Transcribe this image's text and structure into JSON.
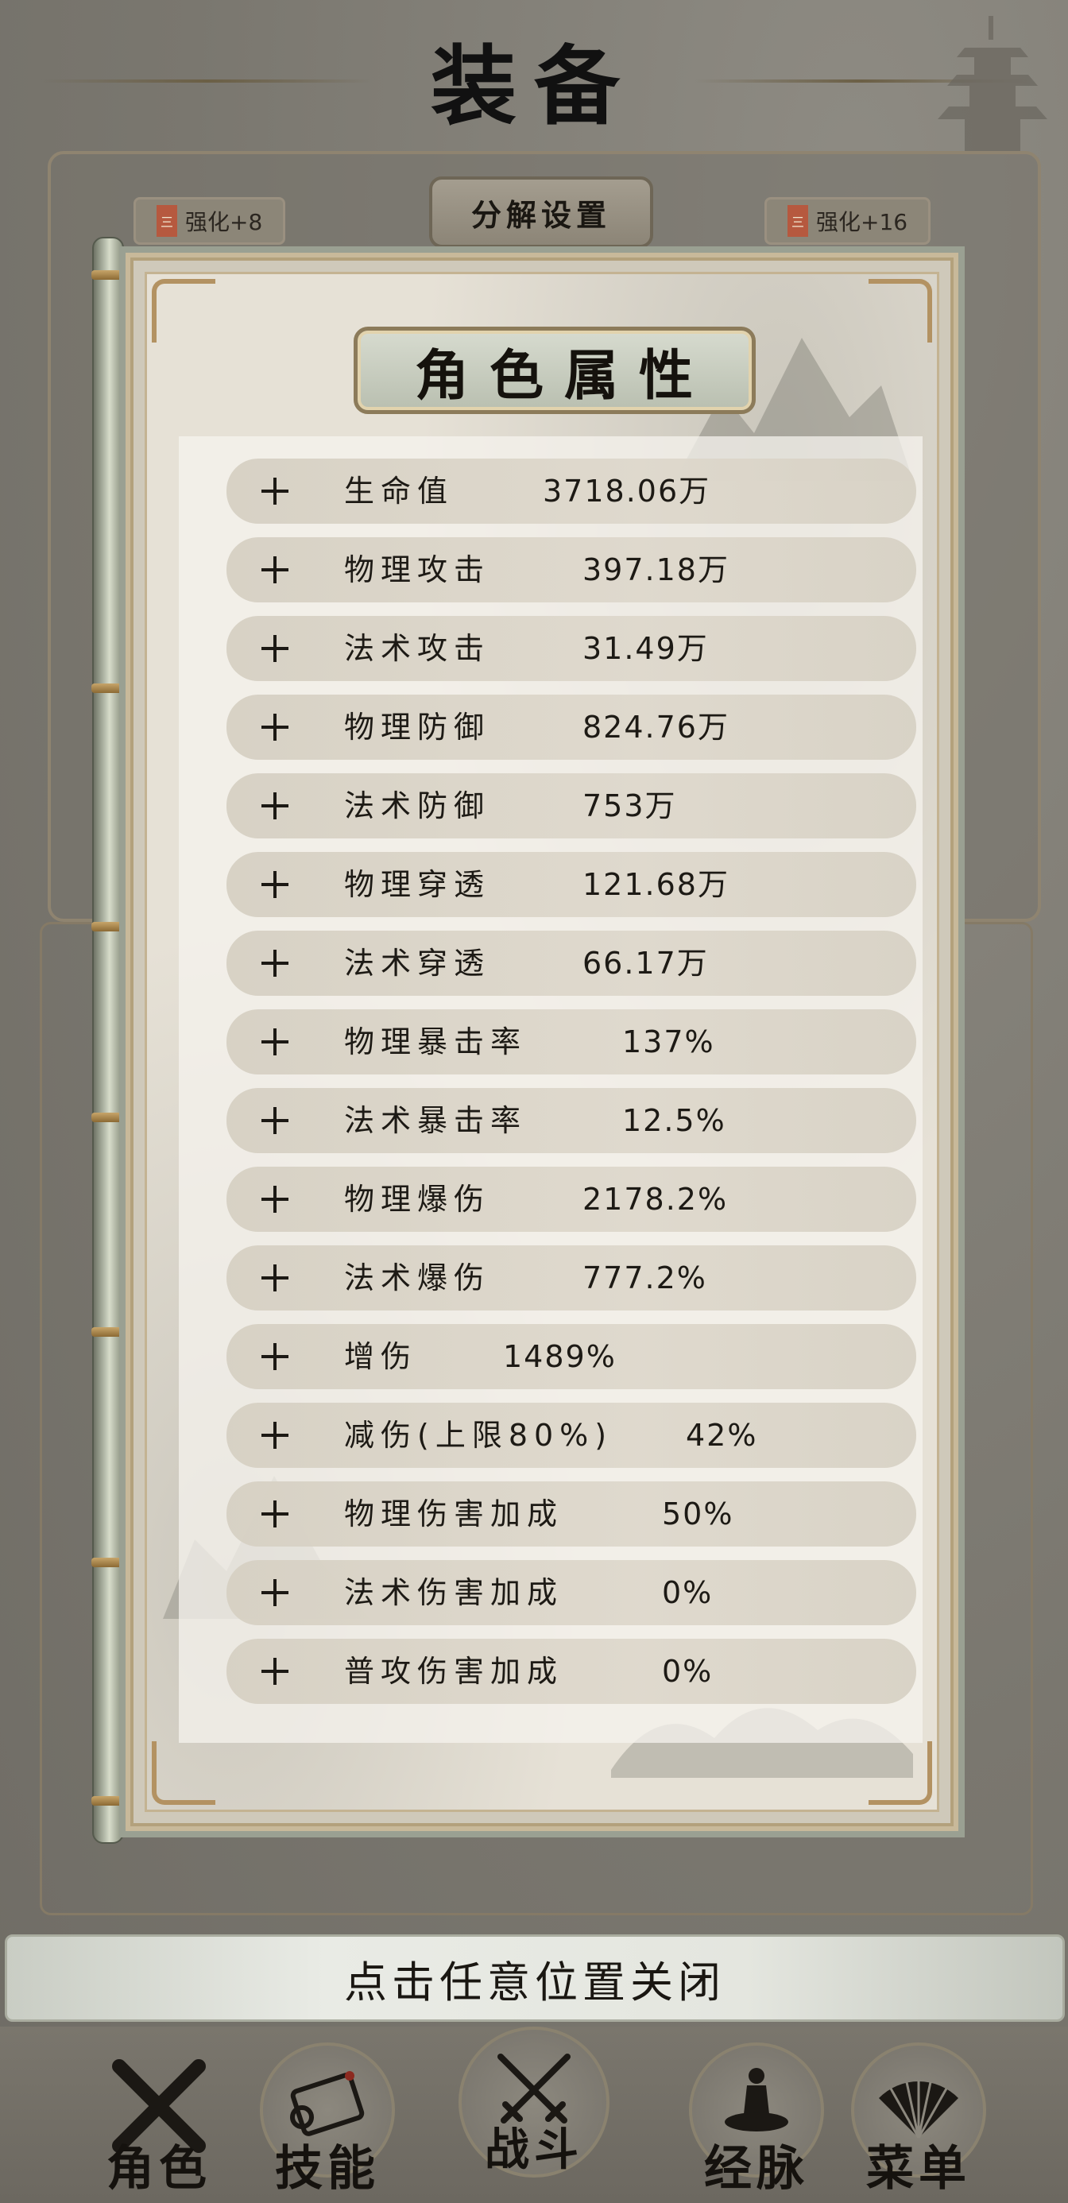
{
  "header": {
    "title": "装备"
  },
  "background_tabs": {
    "left_chip": {
      "label": "强化+8",
      "badge": "三"
    },
    "right_chip": {
      "label": "强化+16",
      "badge": "三"
    },
    "decompose_button": "分解设置"
  },
  "modal": {
    "title": "角色属性",
    "stats": [
      {
        "name": "生命值",
        "value": "3718.06万"
      },
      {
        "name": "物理攻击",
        "value": "397.18万"
      },
      {
        "name": "法术攻击",
        "value": "31.49万"
      },
      {
        "name": "物理防御",
        "value": "824.76万"
      },
      {
        "name": "法术防御",
        "value": "753万"
      },
      {
        "name": "物理穿透",
        "value": "121.68万"
      },
      {
        "name": "法术穿透",
        "value": "66.17万"
      },
      {
        "name": "物理暴击率",
        "value": "137%"
      },
      {
        "name": "法术暴击率",
        "value": "12.5%"
      },
      {
        "name": "物理爆伤",
        "value": "2178.2%"
      },
      {
        "name": "法术爆伤",
        "value": "777.2%"
      },
      {
        "name": "增伤",
        "value": "1489%"
      },
      {
        "name": "减伤(上限80%)",
        "value": "42%"
      },
      {
        "name": "物理伤害加成",
        "value": "50%"
      },
      {
        "name": "法术伤害加成",
        "value": "0%"
      },
      {
        "name": "普攻伤害加成",
        "value": "0%"
      }
    ]
  },
  "close_hint": "点击任意位置关闭",
  "bottom_nav": {
    "items": [
      {
        "label": "角色",
        "icon": "crossed-swords-x-icon"
      },
      {
        "label": "技能",
        "icon": "scroll-icon"
      },
      {
        "label": "战斗",
        "icon": "crossed-swords-icon"
      },
      {
        "label": "经脉",
        "icon": "meditation-icon"
      },
      {
        "label": "菜单",
        "icon": "fan-icon"
      }
    ]
  }
}
